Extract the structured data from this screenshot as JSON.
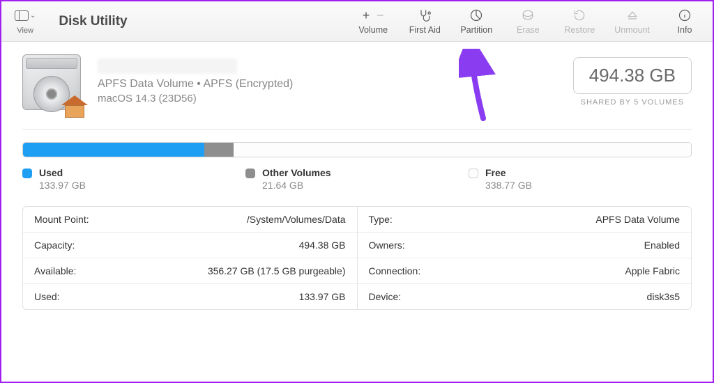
{
  "app": {
    "title": "Disk Utility",
    "view_label": "View"
  },
  "toolbar": {
    "volume": "Volume",
    "first_aid": "First Aid",
    "partition": "Partition",
    "erase": "Erase",
    "restore": "Restore",
    "unmount": "Unmount",
    "info": "Info"
  },
  "volume": {
    "subtitle": "APFS Data Volume • APFS (Encrypted)",
    "os": "macOS 14.3 (23D56)",
    "capacity": "494.38 GB",
    "shared_caption": "SHARED BY 5 VOLUMES"
  },
  "usage": {
    "used_label": "Used",
    "used_value": "133.97 GB",
    "other_label": "Other Volumes",
    "other_value": "21.64 GB",
    "free_label": "Free",
    "free_value": "338.77 GB",
    "bar_pct": {
      "used": 27.1,
      "other": 4.4,
      "free": 68.5
    }
  },
  "details": {
    "left": [
      {
        "k": "Mount Point:",
        "v": "/System/Volumes/Data"
      },
      {
        "k": "Capacity:",
        "v": "494.38 GB"
      },
      {
        "k": "Available:",
        "v": "356.27 GB (17.5 GB purgeable)"
      },
      {
        "k": "Used:",
        "v": "133.97 GB"
      }
    ],
    "right": [
      {
        "k": "Type:",
        "v": "APFS Data Volume"
      },
      {
        "k": "Owners:",
        "v": "Enabled"
      },
      {
        "k": "Connection:",
        "v": "Apple Fabric"
      },
      {
        "k": "Device:",
        "v": "disk3s5"
      }
    ]
  }
}
